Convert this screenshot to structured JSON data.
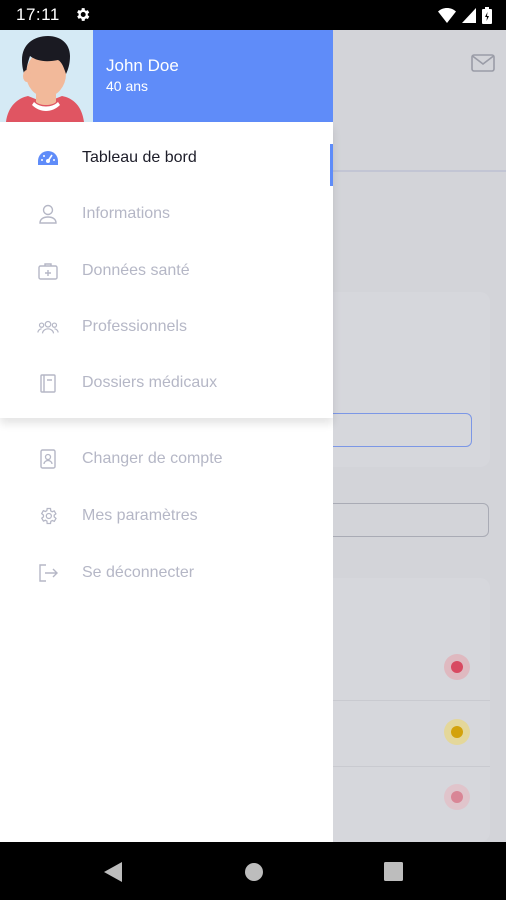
{
  "status_bar": {
    "time": "17:11"
  },
  "user": {
    "name": "John Doe",
    "age": "40 ans"
  },
  "menu_primary": [
    {
      "label": "Tableau de bord",
      "icon": "dashboard-icon",
      "active": true
    },
    {
      "label": "Informations",
      "icon": "user-icon"
    },
    {
      "label": "Données santé",
      "icon": "medical-kit-icon"
    },
    {
      "label": "Professionnels",
      "icon": "group-icon"
    },
    {
      "label": "Dossiers médicaux",
      "icon": "folder-icon"
    }
  ],
  "menu_secondary": [
    {
      "label": "Changer de compte",
      "icon": "switch-account-icon"
    },
    {
      "label": "Mes paramètres",
      "icon": "settings-icon"
    },
    {
      "label": "Se déconnecter",
      "icon": "logout-icon"
    }
  ],
  "colors": {
    "accent": "#5f8cf9",
    "inactive_text": "#b5b7c6",
    "active_text": "#1d1d29"
  }
}
